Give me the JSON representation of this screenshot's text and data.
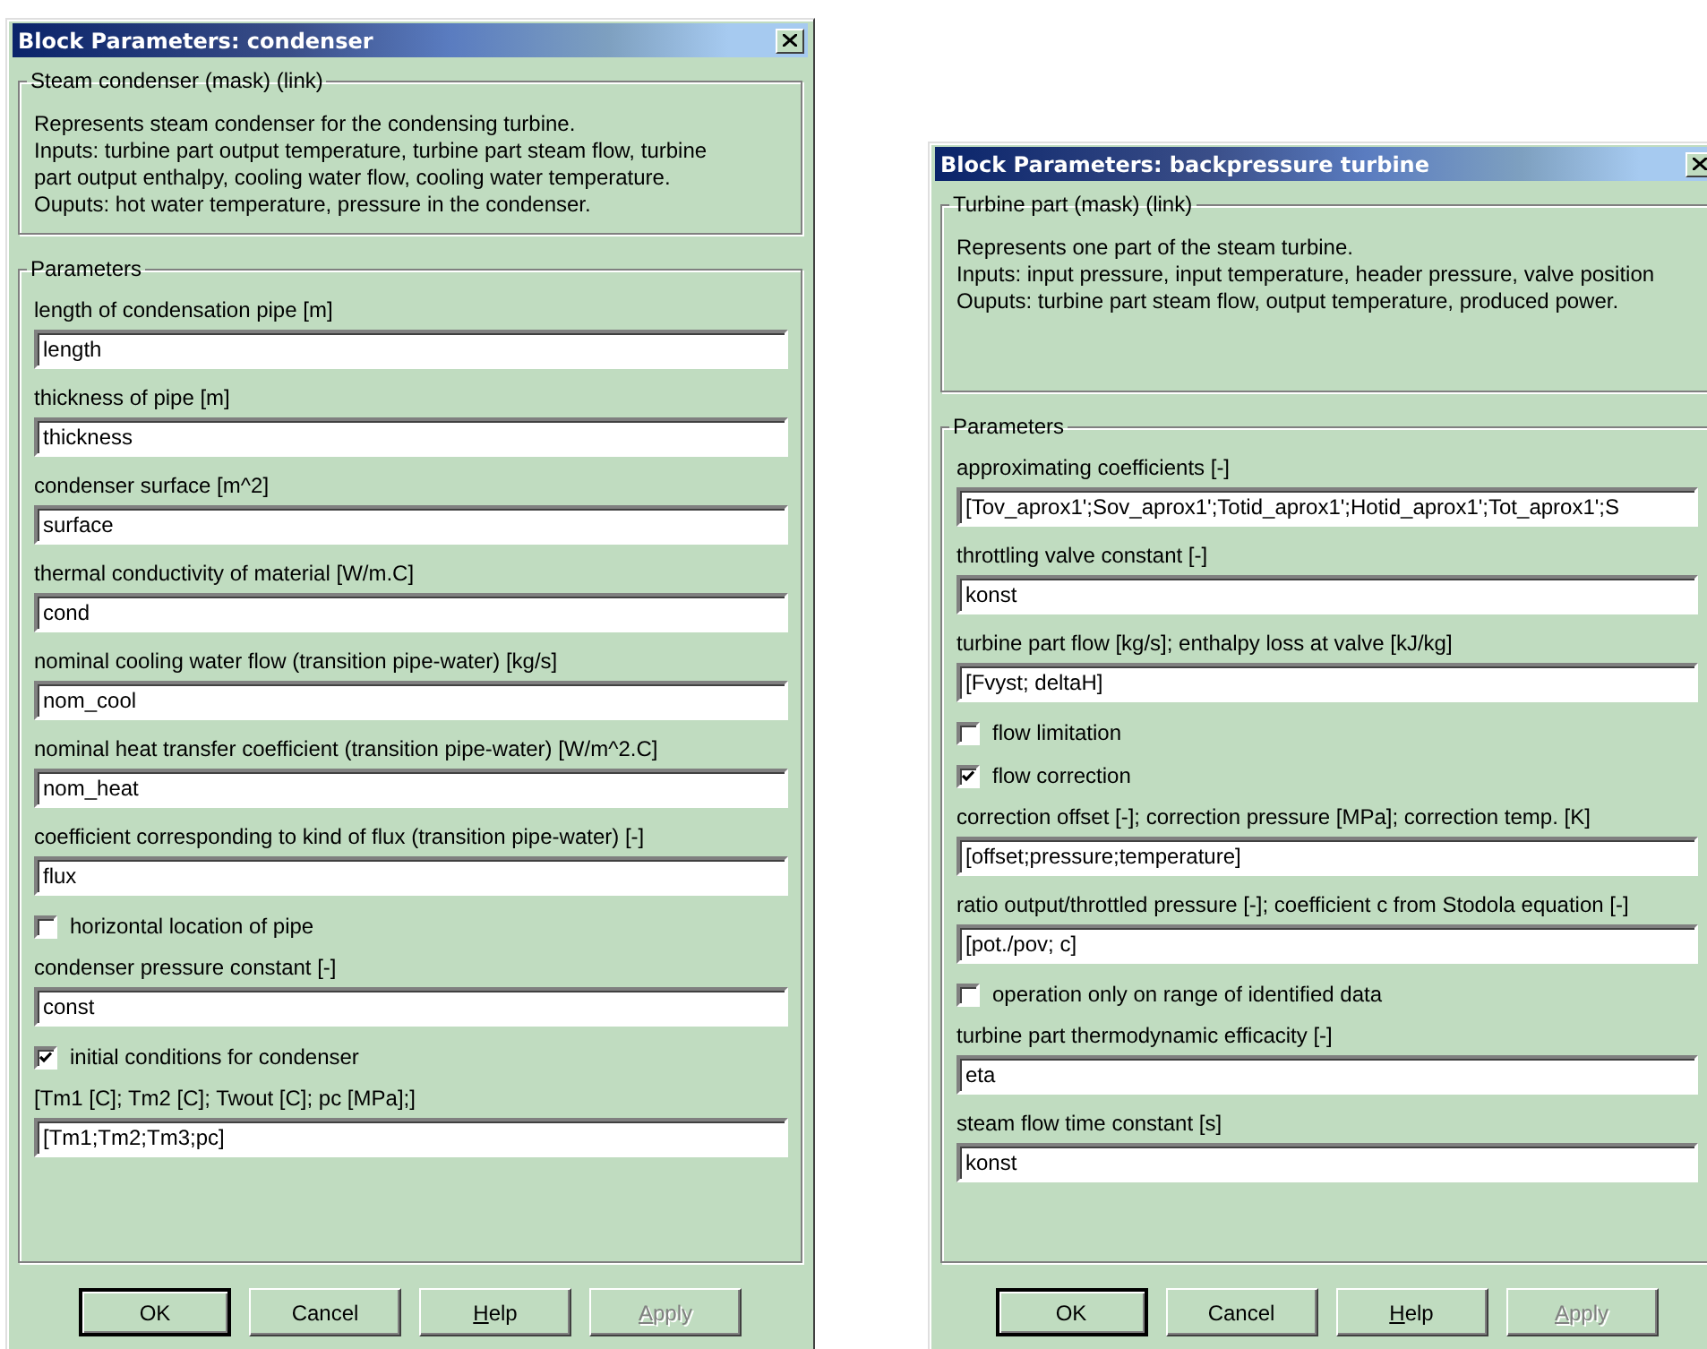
{
  "windows": [
    {
      "title": "Block Parameters: condenser",
      "description": {
        "title": "Steam condenser (mask) (link)",
        "lines": [
          "Represents steam condenser for the condensing turbine.",
          "Inputs: turbine part output temperature, turbine part steam flow, turbine",
          "part output enthalpy, cooling water flow, cooling water temperature.",
          "Ouputs: hot water temperature, pressure in the condenser."
        ]
      },
      "parameters": {
        "title": "Parameters",
        "items": [
          {
            "kind": "field",
            "label": "length of condensation pipe [m]",
            "value": "length"
          },
          {
            "kind": "field",
            "label": "thickness of pipe [m]",
            "value": "thickness"
          },
          {
            "kind": "field",
            "label": "condenser surface [m^2]",
            "value": "surface"
          },
          {
            "kind": "field",
            "label": "thermal conductivity of  material [W/m.C]",
            "value": "cond"
          },
          {
            "kind": "field",
            "label": "nominal cooling water flow (transition pipe-water) [kg/s]",
            "value": "nom_cool"
          },
          {
            "kind": "field",
            "label": "nominal heat transfer coefficient (transition pipe-water) [W/m^2.C]",
            "value": "nom_heat"
          },
          {
            "kind": "field",
            "label": "coefficient corresponding to kind of flux (transition pipe-water) [-]",
            "value": "flux"
          },
          {
            "kind": "checkbox",
            "label": "horizontal location of pipe",
            "checked": false
          },
          {
            "kind": "field",
            "label": "condenser pressure constant [-]",
            "value": "const"
          },
          {
            "kind": "checkbox",
            "label": "initial conditions  for condenser",
            "checked": true
          },
          {
            "kind": "field",
            "label": "[Tm1 [C]; Tm2 [C]; Twout [C]; pc [MPa];]",
            "value": "[Tm1;Tm2;Tm3;pc]"
          }
        ]
      },
      "buttons": [
        {
          "label": "OK",
          "default": true,
          "disabled": false,
          "underline_first": false
        },
        {
          "label": "Cancel",
          "default": false,
          "disabled": false,
          "underline_first": false
        },
        {
          "label": "Help",
          "default": false,
          "disabled": false,
          "underline_first": true
        },
        {
          "label": "Apply",
          "default": false,
          "disabled": true,
          "underline_first": true
        }
      ]
    },
    {
      "title": "Block Parameters: backpressure turbine",
      "description": {
        "title": "Turbine part (mask) (link)",
        "lines": [
          "Represents one part of the steam turbine.",
          "Inputs: input pressure, input temperature, header pressure, valve position",
          "Ouputs: turbine part steam flow, output temperature, produced power."
        ]
      },
      "parameters": {
        "title": "Parameters",
        "items": [
          {
            "kind": "field",
            "label": "approximating coefficients [-]",
            "value": "[Tov_aprox1';Sov_aprox1';Totid_aprox1';Hotid_aprox1';Tot_aprox1';S"
          },
          {
            "kind": "field",
            "label": "throttling valve constant [-]",
            "value": "konst"
          },
          {
            "kind": "field",
            "label": "turbine part flow [kg/s]; enthalpy loss at valve [kJ/kg]",
            "value": "[Fvyst; deltaH]"
          },
          {
            "kind": "checkbox",
            "label": "flow limitation",
            "checked": false
          },
          {
            "kind": "checkbox",
            "label": "flow correction",
            "checked": true
          },
          {
            "kind": "field",
            "label": "correction offset [-]; correction pressure [MPa]; correction temp. [K]",
            "value": "[offset;pressure;temperature]"
          },
          {
            "kind": "field",
            "label": "ratio output/throttled pressure [-]; coefficient c from Stodola equation [-]",
            "value": "[pot./pov; c]"
          },
          {
            "kind": "checkbox",
            "label": "operation only on range of identified data",
            "checked": false
          },
          {
            "kind": "field",
            "label": "turbine part thermodynamic efficacity  [-]",
            "value": "eta"
          },
          {
            "kind": "field",
            "label": "steam flow time constant [s]",
            "value": "konst"
          }
        ]
      },
      "buttons": [
        {
          "label": "OK",
          "default": true,
          "disabled": false,
          "underline_first": false
        },
        {
          "label": "Cancel",
          "default": false,
          "disabled": false,
          "underline_first": false
        },
        {
          "label": "Help",
          "default": false,
          "disabled": false,
          "underline_first": true
        },
        {
          "label": "Apply",
          "default": false,
          "disabled": true,
          "underline_first": true
        }
      ]
    }
  ]
}
